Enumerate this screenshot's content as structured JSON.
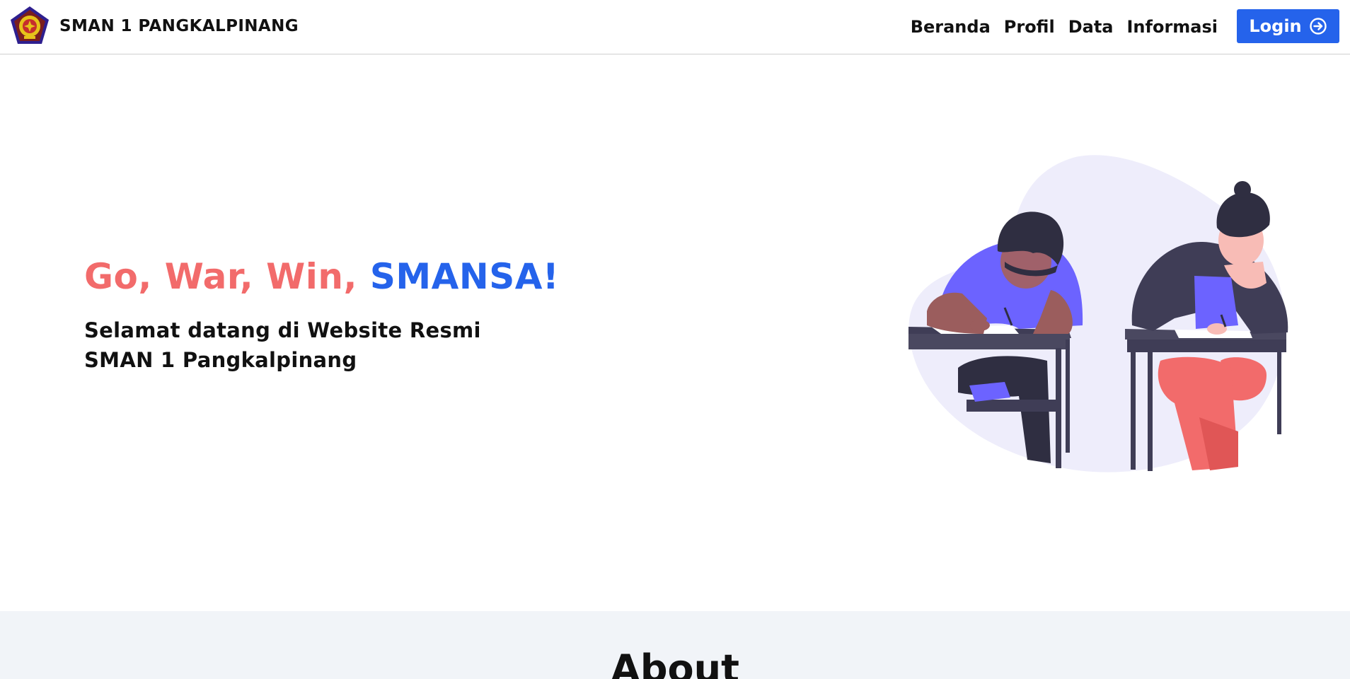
{
  "header": {
    "brand_name": "SMAN 1 PANGKALPINANG",
    "logo_icon": "school-crest-logo",
    "nav": [
      {
        "label": "Beranda"
      },
      {
        "label": "Profil"
      },
      {
        "label": "Data"
      },
      {
        "label": "Informasi"
      }
    ],
    "login_label": "Login",
    "login_icon": "arrow-right-circle-icon"
  },
  "hero": {
    "title_part1": "Go, War, Win, ",
    "title_part2": "SMANSA!",
    "subtitle_line1": "Selamat datang di Website Resmi",
    "subtitle_line2": "SMAN 1 Pangkalpinang",
    "illustration_icon": "students-taking-exam-illustration"
  },
  "about": {
    "title": "About"
  },
  "colors": {
    "primary": "#2563eb",
    "accent": "#f26b6b",
    "section_bg": "#f1f4f8",
    "illustration_purple": "#6c63ff",
    "illustration_blob": "#eeedfb"
  }
}
